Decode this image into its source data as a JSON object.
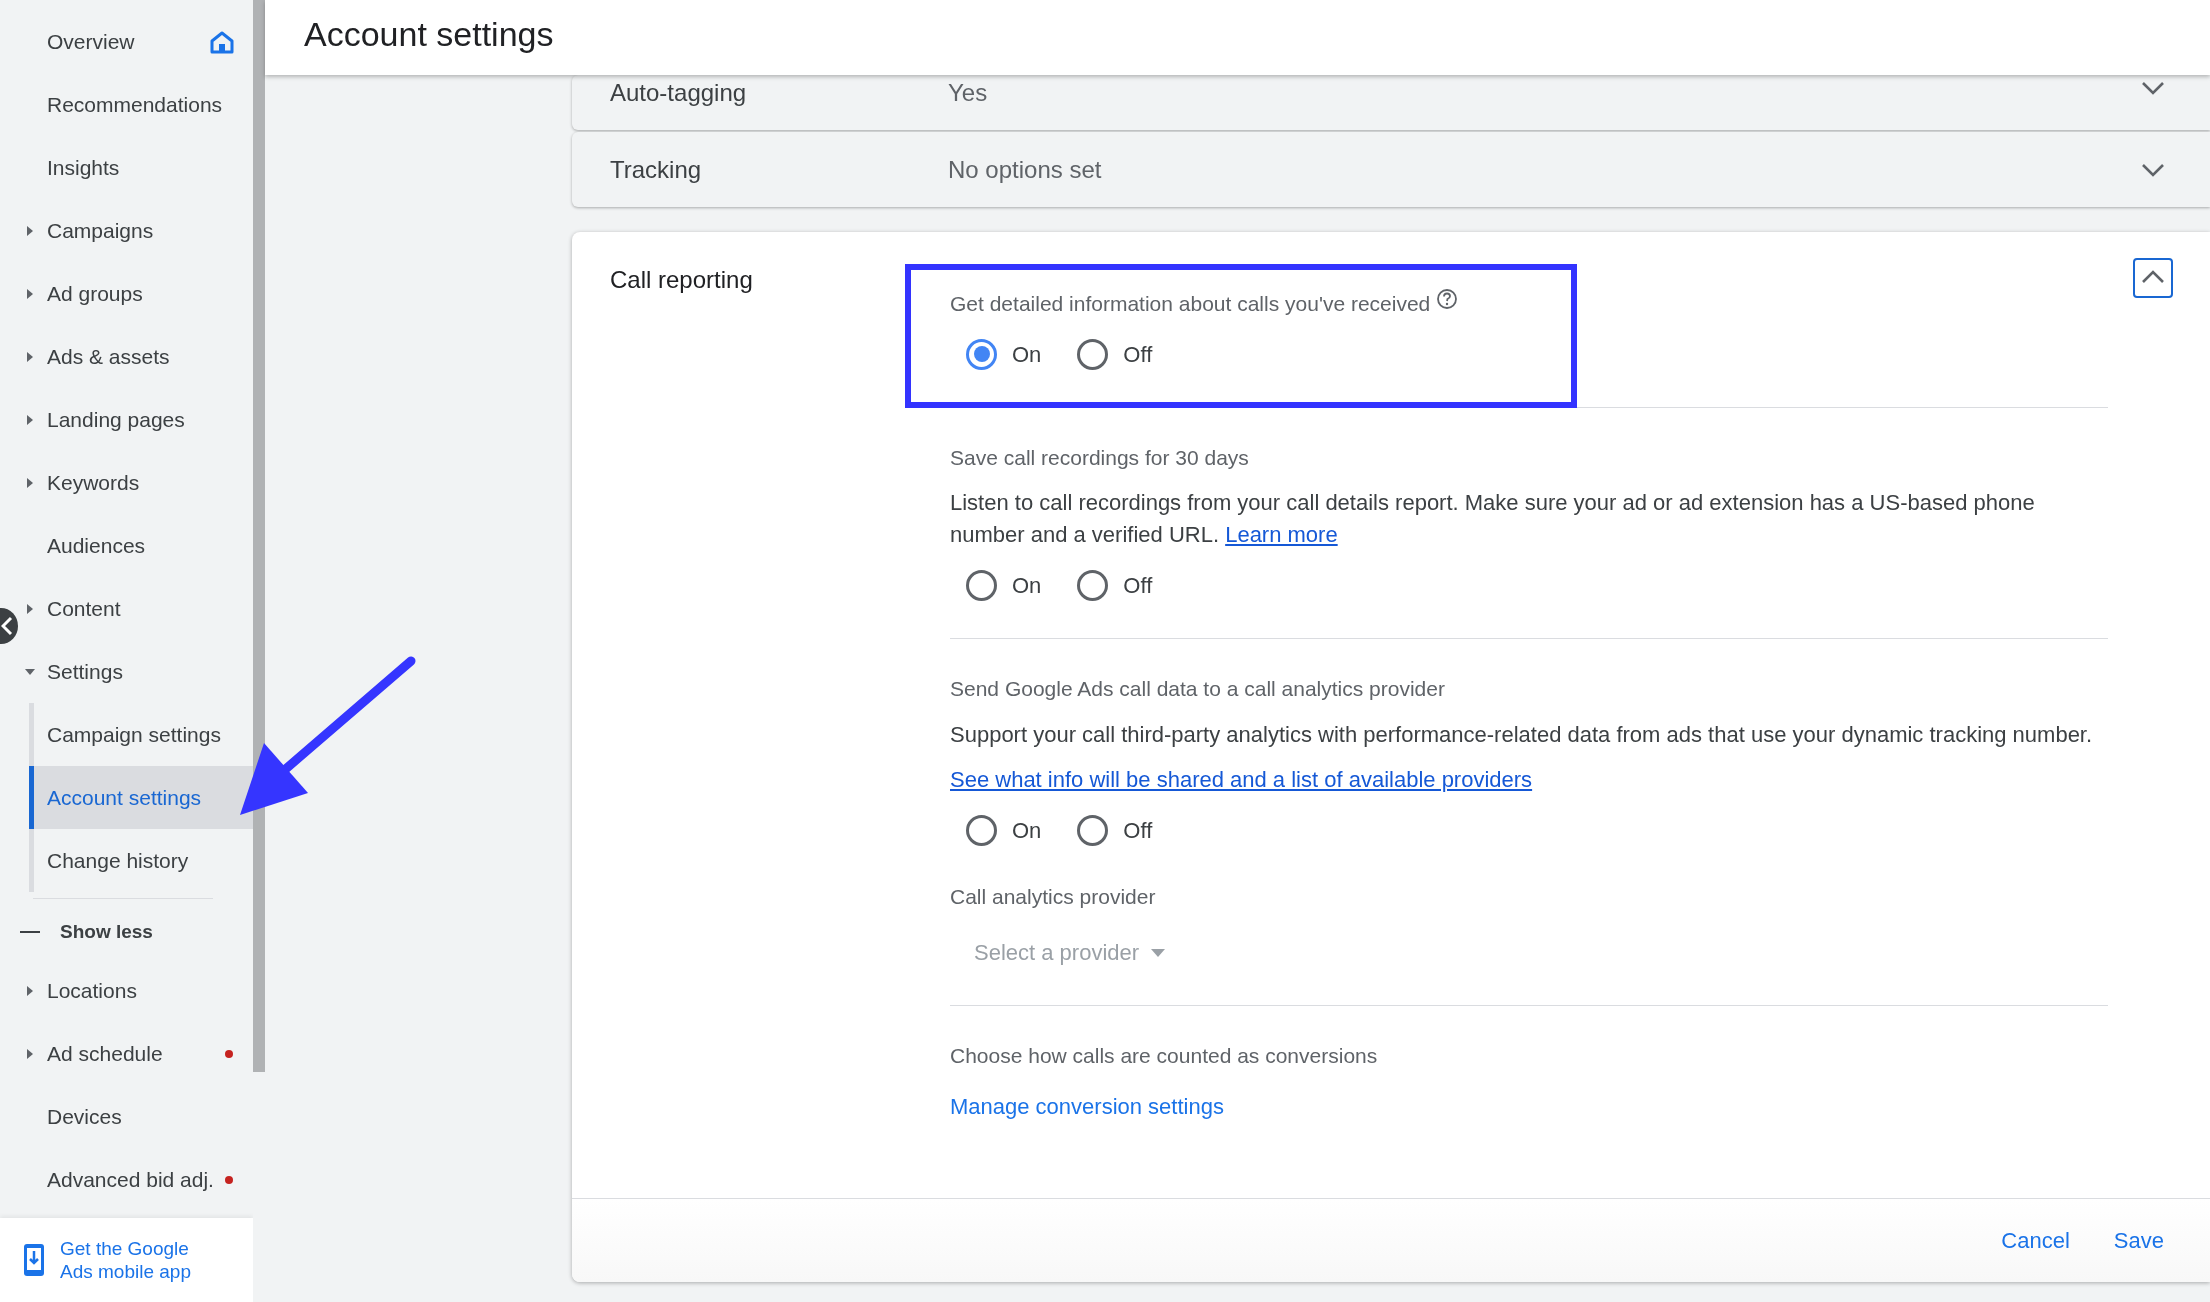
{
  "sidebar": {
    "items": [
      {
        "label": "Overview",
        "kind": "home",
        "selected": false,
        "alert": false
      },
      {
        "label": "Recommendations",
        "kind": "item",
        "selected": false,
        "alert": false
      },
      {
        "label": "Insights",
        "kind": "item",
        "selected": false,
        "alert": false
      },
      {
        "label": "Campaigns",
        "kind": "item",
        "expanded": false,
        "selected": false,
        "alert": false
      },
      {
        "label": "Ad groups",
        "kind": "item",
        "expanded": false,
        "selected": false,
        "alert": false
      },
      {
        "label": "Ads & assets",
        "kind": "item",
        "expanded": false,
        "selected": false,
        "alert": false
      },
      {
        "label": "Landing pages",
        "kind": "item",
        "expanded": false,
        "selected": false,
        "alert": false
      },
      {
        "label": "Keywords",
        "kind": "item",
        "expanded": false,
        "selected": false,
        "alert": false
      },
      {
        "label": "Audiences",
        "kind": "item",
        "selected": false,
        "alert": false
      },
      {
        "label": "Content",
        "kind": "item",
        "expanded": false,
        "selected": false,
        "alert": false
      },
      {
        "label": "Settings",
        "kind": "item",
        "expanded": true,
        "selected": false,
        "alert": false,
        "children": [
          {
            "label": "Campaign settings",
            "selected": false
          },
          {
            "label": "Account settings",
            "selected": true
          },
          {
            "label": "Change history",
            "selected": false
          }
        ]
      },
      {
        "label": "Show less",
        "kind": "toggle",
        "selected": false,
        "alert": false
      },
      {
        "label": "Locations",
        "kind": "item",
        "expanded": false,
        "selected": false,
        "alert": false
      },
      {
        "label": "Ad schedule",
        "kind": "item",
        "expanded": false,
        "selected": false,
        "alert": true
      },
      {
        "label": "Devices",
        "kind": "item",
        "selected": false,
        "alert": false
      },
      {
        "label": "Advanced bid adj.",
        "kind": "item",
        "selected": false,
        "alert": true
      }
    ],
    "promo": "Get the Google Ads mobile app"
  },
  "header": {
    "title": "Account settings"
  },
  "collapsed_sections": [
    {
      "label": "Auto-tagging",
      "value": "Yes"
    },
    {
      "label": "Tracking",
      "value": "No options set"
    }
  ],
  "call_reporting": {
    "title": "Call reporting",
    "expanded": true,
    "settings": [
      {
        "kind": "radio",
        "label": "Get detailed information about calls you've received",
        "help": true,
        "highlighted": true,
        "divider": true,
        "options": [
          {
            "label": "On",
            "selected": true
          },
          {
            "label": "Off",
            "selected": false
          }
        ]
      },
      {
        "kind": "radio",
        "label": "Save call recordings for 30 days",
        "help": false,
        "highlighted": false,
        "divider": true,
        "description": "Listen to call recordings from your call details report. Make sure your ad or ad extension has a US-based phone number and a verified URL.",
        "link": "Learn more",
        "options": [
          {
            "label": "On",
            "selected": false
          },
          {
            "label": "Off",
            "selected": false
          }
        ]
      },
      {
        "kind": "radio",
        "label": "Send Google Ads call data to a call analytics provider",
        "help": false,
        "highlighted": false,
        "divider": false,
        "description": "Support your call third-party analytics with performance-related data from ads that use your dynamic tracking number.",
        "link_below": "See what info will be shared and a list of available providers",
        "options": [
          {
            "label": "On",
            "selected": false
          },
          {
            "label": "Off",
            "selected": false
          }
        ]
      },
      {
        "kind": "select",
        "label": "Call analytics provider",
        "placeholder": "Select a provider",
        "disabled": true,
        "divider": true
      },
      {
        "kind": "link",
        "label": "Choose how calls are counted as conversions",
        "link": "Manage conversion settings",
        "divider": false
      }
    ],
    "buttons": [
      "Cancel",
      "Save"
    ]
  }
}
